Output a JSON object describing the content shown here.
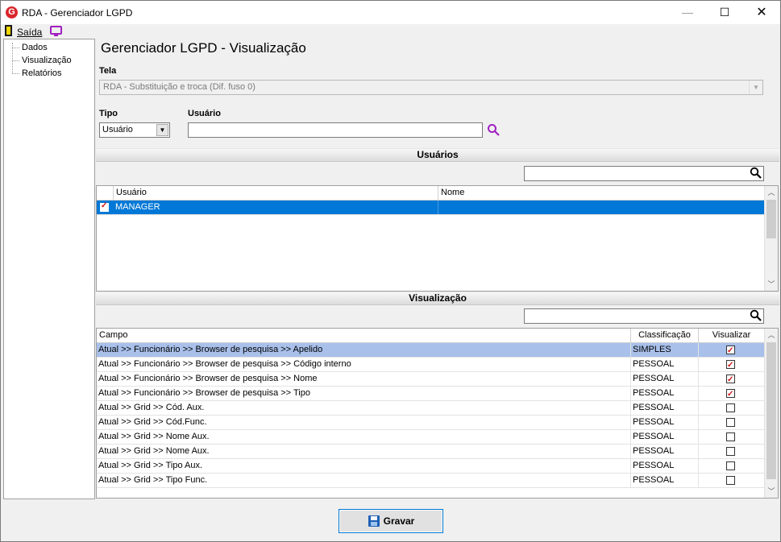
{
  "window": {
    "title": "RDA - Gerenciador LGPD",
    "app_icon_letter": "G"
  },
  "toolbar": {
    "exit_label": "Saída"
  },
  "sidebar": {
    "items": [
      "Dados",
      "Visualização",
      "Relatórios"
    ]
  },
  "main": {
    "title": "Gerenciador LGPD - Visualização",
    "tela_label": "Tela",
    "tela_value": "RDA - Substituição e troca (Dif. fuso 0)",
    "tipo_label": "Tipo",
    "tipo_value": "Usuário",
    "usuario_label": "Usuário",
    "usuario_value": ""
  },
  "users_section": {
    "title": "Usuários",
    "search_value": "",
    "columns": [
      "Usuário",
      "Nome"
    ],
    "rows": [
      {
        "usuario": "MANAGER",
        "nome": "",
        "checked": true
      }
    ]
  },
  "view_section": {
    "title": "Visualização",
    "search_value": "",
    "columns": [
      "Campo",
      "Classificação",
      "Visualizar"
    ],
    "rows": [
      {
        "campo": "Atual >> Funcionário >> Browser de pesquisa >> Apelido",
        "classificacao": "SIMPLES",
        "visualizar": true
      },
      {
        "campo": "Atual >> Funcionário >> Browser de pesquisa >> Código interno",
        "classificacao": "PESSOAL",
        "visualizar": true
      },
      {
        "campo": "Atual >> Funcionário >> Browser de pesquisa >> Nome",
        "classificacao": "PESSOAL",
        "visualizar": true
      },
      {
        "campo": "Atual >> Funcionário >> Browser de pesquisa >> Tipo",
        "classificacao": "PESSOAL",
        "visualizar": true
      },
      {
        "campo": "Atual >> Grid >> Cód. Aux.",
        "classificacao": "PESSOAL",
        "visualizar": false
      },
      {
        "campo": "Atual >> Grid >> Cód.Func.",
        "classificacao": "PESSOAL",
        "visualizar": false
      },
      {
        "campo": "Atual >> Grid >> Nome Aux.",
        "classificacao": "PESSOAL",
        "visualizar": false
      },
      {
        "campo": "Atual >> Grid >> Nome Aux.",
        "classificacao": "PESSOAL",
        "visualizar": false
      },
      {
        "campo": "Atual >> Grid >> Tipo Aux.",
        "classificacao": "PESSOAL",
        "visualizar": false
      },
      {
        "campo": "Atual >> Grid >> Tipo Func.",
        "classificacao": "PESSOAL",
        "visualizar": false
      }
    ]
  },
  "footer": {
    "save_label": "Gravar"
  },
  "colors": {
    "selection": "#0078d7",
    "highlight_row": "#a8c0ea",
    "accent_purple": "#a020c0",
    "check_red": "#d41010"
  }
}
